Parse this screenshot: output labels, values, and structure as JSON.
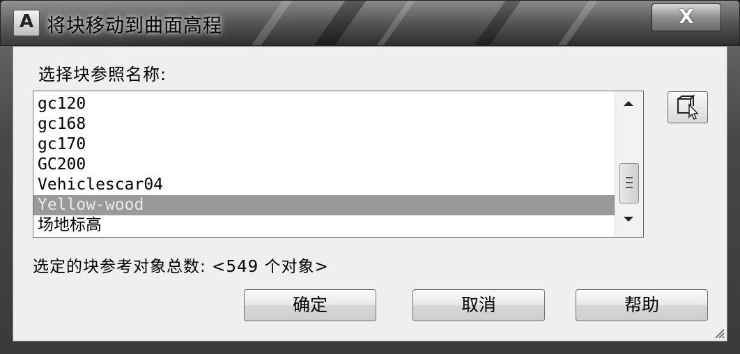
{
  "window": {
    "title": "将块移动到曲面高程",
    "app_icon_letter": "A",
    "close_label": "X"
  },
  "dialog": {
    "select_label": "选择块参照名称:",
    "items": [
      "gc120",
      "gc168",
      "gc170",
      "GC200",
      "Vehiclescar04",
      "Yellow-wood",
      "场地标高"
    ],
    "selected_index": 5,
    "count_text": "选定的块参考对象总数: <549 个对象>",
    "buttons": {
      "ok": "确定",
      "cancel": "取消",
      "help": "帮助"
    }
  }
}
